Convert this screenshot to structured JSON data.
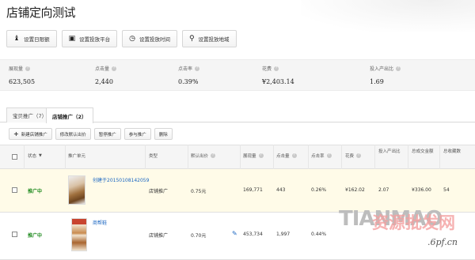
{
  "page": {
    "title": "店铺定向测试"
  },
  "actions": [
    {
      "label": "设置日限额"
    },
    {
      "label": "设置投放平台"
    },
    {
      "label": "设置投放时间"
    },
    {
      "label": "设置投放地域"
    }
  ],
  "stats": [
    {
      "label": "展现量",
      "value": "623,505"
    },
    {
      "label": "点击量",
      "value": "2,440"
    },
    {
      "label": "点击率",
      "value": "0.39%"
    },
    {
      "label": "花费",
      "value": "¥2,403.14"
    },
    {
      "label": "投入产出比",
      "value": "1.69"
    }
  ],
  "tabs": [
    {
      "label": "宝贝推广（7）"
    },
    {
      "label": "店铺推广（2）"
    }
  ],
  "toolbar": {
    "new": "新建店铺推广",
    "bid": "修改默认出价",
    "pause": "暂停推广",
    "resume": "参与推广",
    "delete": "删除"
  },
  "columns": [
    "状态",
    "推广单元",
    "类型",
    "默认出价",
    "展现量",
    "点击量",
    "点击率",
    "花费",
    "投入产出比",
    "总成交金额",
    "总收藏数"
  ],
  "rows": [
    {
      "status": "推广中",
      "unit": "创建于20150108142059",
      "type": "店铺推广",
      "bid": "0.75元",
      "impressions": "169,771",
      "clicks": "443",
      "ctr": "0.26%",
      "cost": "¥162.02",
      "roi": "2.07",
      "gmv": "¥336.00",
      "favs": "54"
    },
    {
      "status": "推广中",
      "unit": "商帮鞋",
      "type": "店铺推广",
      "bid": "0.70元",
      "impressions": "453,734",
      "clicks": "1,997",
      "ctr": "0.44%",
      "cost": "",
      "roi": "",
      "gmv": "",
      "favs": ""
    }
  ],
  "watermark": {
    "text": "TIANMAO",
    "cn": "资源批发网",
    "url": ".6pf.cn"
  },
  "colors": {
    "status_green": "#1e8a1e",
    "link_blue": "#1a66c2",
    "row_highlight": "#fffbe8"
  }
}
